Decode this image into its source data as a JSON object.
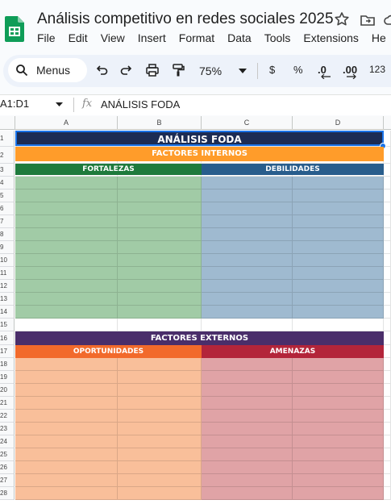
{
  "app": {
    "title": "Análisis competitivo en redes sociales 2025"
  },
  "menu": [
    "File",
    "Edit",
    "View",
    "Insert",
    "Format",
    "Data",
    "Tools",
    "Extensions",
    "He"
  ],
  "toolbar": {
    "search_label": "Menus",
    "zoom": "75%",
    "currency": "$",
    "percent": "%",
    "dec_decrease": ".0",
    "dec_increase": ".00",
    "number_format": "123"
  },
  "formula_bar": {
    "namebox": "A1:D1",
    "fx": "fx",
    "value": "ANÁLISIS FODA"
  },
  "columns": [
    "A",
    "B",
    "C",
    "D"
  ],
  "rows": [
    "1",
    "2",
    "3",
    "4",
    "5",
    "6",
    "7",
    "8",
    "9",
    "10",
    "11",
    "12",
    "13",
    "14",
    "15",
    "16",
    "17",
    "18",
    "19",
    "20",
    "21",
    "22",
    "23",
    "24",
    "25",
    "26",
    "27",
    "28"
  ],
  "sheet": {
    "title": "ANÁLISIS FODA",
    "internos": "FACTORES INTERNOS",
    "fortalezas": "FORTALEZAS",
    "debilidades": "DEBILIDADES",
    "externos": "FACTORES EXTERNOS",
    "oportunidades": "OPORTUNIDADES",
    "amenazas": "AMENAZAS"
  },
  "colors": {
    "title_bg": "#1c2c54",
    "internos_bg": "#ff9c2a",
    "fortalezas_bg": "#1e7a3c",
    "fortalezas_fill": "#a1cba6",
    "debilidades_bg": "#285d8c",
    "debilidades_fill": "#9fbad0",
    "externos_bg": "#4a2e6a",
    "oportunidades_bg": "#f26a2b",
    "oportunidades_fill": "#f9bf9a",
    "amenazas_bg": "#b3253a",
    "amenazas_fill": "#e0a3a6"
  }
}
